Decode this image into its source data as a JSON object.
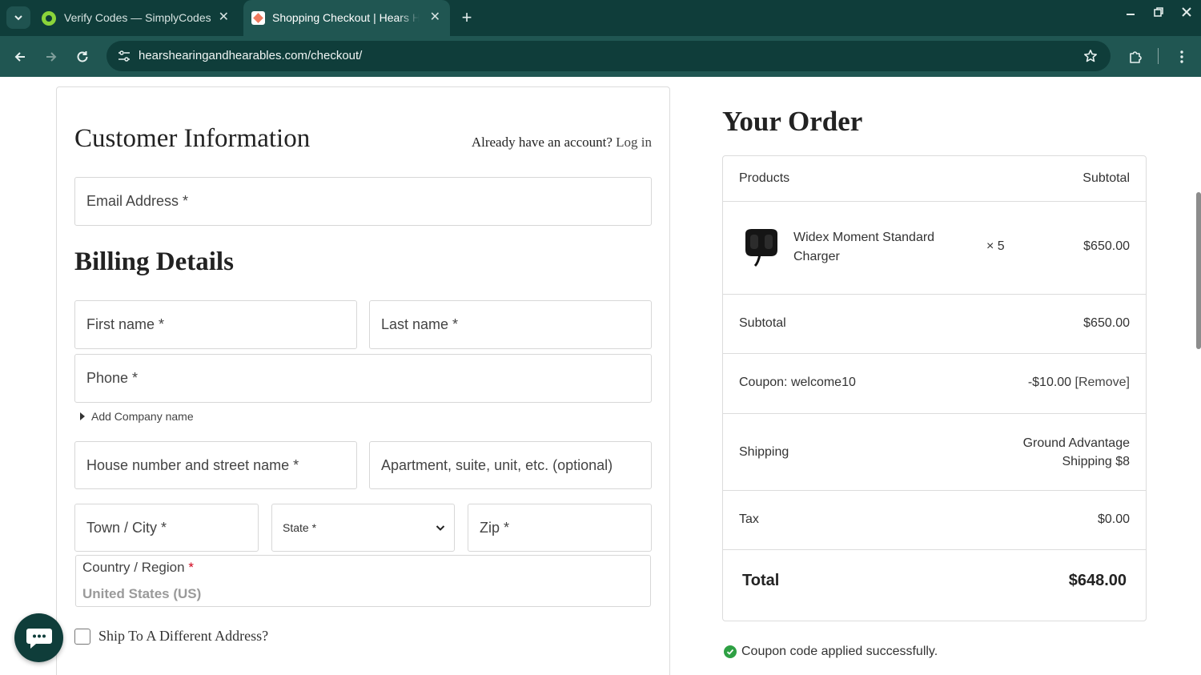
{
  "browser": {
    "tabs": [
      {
        "title": "Verify Codes — SimplyCodes",
        "active": false
      },
      {
        "title": "Shopping Checkout | Hears Hearing and Hearables",
        "active": true
      }
    ],
    "url": "hearshearingandhearables.com/checkout/",
    "icons": {
      "tab_list": "chevron-down-icon",
      "new_tab": "plus-icon",
      "minimize": "minimize-icon",
      "restore": "restore-icon",
      "close": "close-icon",
      "back": "arrow-left-icon",
      "forward": "arrow-right-icon",
      "reload": "reload-icon",
      "site_info": "tune-icon",
      "bookmark": "star-icon",
      "extensions": "puzzle-icon",
      "menu": "kebab-icon"
    }
  },
  "checkout": {
    "customer_info_title": "Customer Information",
    "account_prompt": "Already have an account?",
    "login_link": "Log in",
    "email_placeholder": "Email Address *",
    "billing_title": "Billing Details",
    "first_name_placeholder": "First name *",
    "last_name_placeholder": "Last name *",
    "phone_placeholder": "Phone *",
    "add_company": "Add Company name",
    "street_placeholder": "House number and street name *",
    "apartment_placeholder": "Apartment, suite, unit, etc. (optional)",
    "city_placeholder": "Town / City *",
    "state_label": "State *",
    "zip_placeholder": "Zip *",
    "country_label": "Country / Region",
    "country_required_mark": "*",
    "country_value": "United States (US)",
    "ship_different": "Ship To A Different Address?",
    "ship_different_checked": false
  },
  "order": {
    "title": "Your Order",
    "header_products": "Products",
    "header_subtotal": "Subtotal",
    "item": {
      "name": "Widex Moment Standard Charger",
      "quantity": "× 5",
      "price": "$650.00"
    },
    "subtotal_label": "Subtotal",
    "subtotal_value": "$650.00",
    "coupon_label": "Coupon: welcome10",
    "coupon_value": "-$10.00",
    "coupon_remove": "[Remove]",
    "shipping_label": "Shipping",
    "shipping_line1": "Ground Advantage",
    "shipping_line2": "Shipping $8",
    "tax_label": "Tax",
    "tax_value": "$0.00",
    "total_label": "Total",
    "total_value": "$648.00",
    "notice": "Coupon code applied successfully."
  },
  "colors": {
    "chrome_dark": "#0f3d3a",
    "chrome_light": "#205652",
    "success": "#2ea043",
    "required": "#d0021b"
  }
}
